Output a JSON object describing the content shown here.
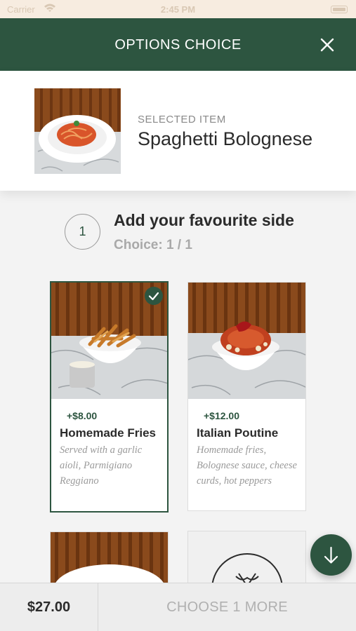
{
  "status_bar": {
    "carrier": "Carrier",
    "time": "2:45 PM"
  },
  "header": {
    "title": "OPTIONS CHOICE"
  },
  "selected_item": {
    "label": "SELECTED ITEM",
    "name": "Spaghetti Bolognese"
  },
  "section": {
    "step": "1",
    "title": "Add your favourite side",
    "choice": "Choice: 1 / 1"
  },
  "options": [
    {
      "price": "+$8.00",
      "name": "Homemade Fries",
      "desc": "Served with a garlic aioli, Parmigiano Reggiano",
      "selected": true
    },
    {
      "price": "+$12.00",
      "name": "Italian Poutine",
      "desc": "Homemade fries, Bolognese sauce, cheese curds, hot peppers",
      "selected": false
    }
  ],
  "bottom_bar": {
    "total": "$27.00",
    "cta": "CHOOSE 1 MORE"
  },
  "icons": {
    "close": "close-icon",
    "check": "check-icon",
    "scroll_down": "arrow-down-icon",
    "no_image": "fork-knife-icon"
  },
  "colors": {
    "brand_green": "#2d5540",
    "status_bar_bg": "#f7ece0",
    "muted_text": "#9a9a9a"
  }
}
